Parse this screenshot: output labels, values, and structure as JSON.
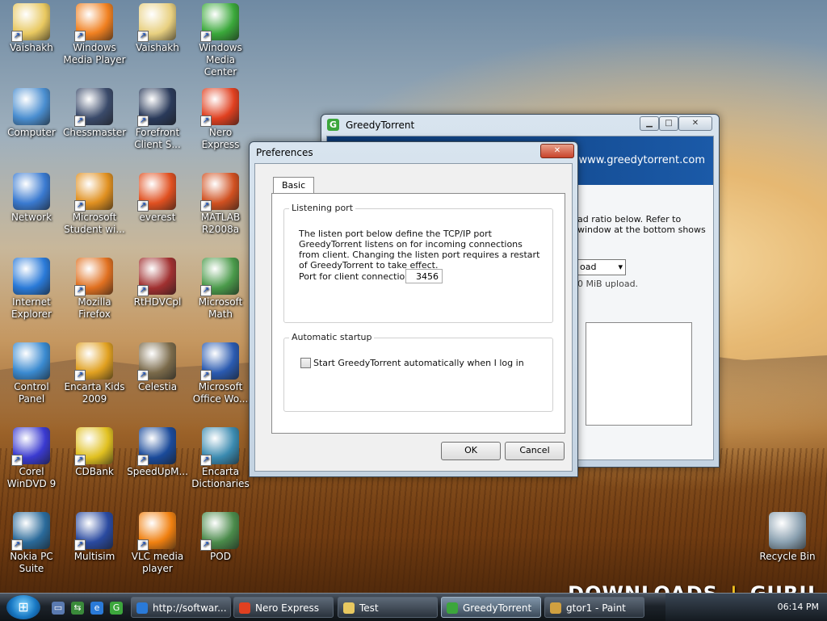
{
  "desktop": {
    "icons": [
      {
        "label": "Vaishakh",
        "icon": "folder-icon",
        "color": "#e8c860"
      },
      {
        "label": "Windows Media Player",
        "icon": "media-player-icon",
        "color": "#f08020"
      },
      {
        "label": "Vaishakh",
        "icon": "folder-doc-icon",
        "color": "#e8d080"
      },
      {
        "label": "Windows Media Center",
        "icon": "media-center-icon",
        "color": "#3aa83a"
      },
      {
        "label": "Computer",
        "icon": "computer-icon",
        "color": "#4a8ed0"
      },
      {
        "label": "Chessmaster",
        "icon": "chess-knight-icon",
        "color": "#3a4a6a"
      },
      {
        "label": "Forefront Client S...",
        "icon": "forefront-icon",
        "color": "#2a3a5a"
      },
      {
        "label": "Nero Express",
        "icon": "nero-icon",
        "color": "#e04020"
      },
      {
        "label": "Network",
        "icon": "network-icon",
        "color": "#3a7ad0"
      },
      {
        "label": "Microsoft Student wi...",
        "icon": "backpack-icon",
        "color": "#e09020"
      },
      {
        "label": "everest",
        "icon": "everest-icon",
        "color": "#e05020"
      },
      {
        "label": "MATLAB R2008a",
        "icon": "matlab-icon",
        "color": "#d05020"
      },
      {
        "label": "Internet Explorer",
        "icon": "internet-explorer-icon",
        "color": "#2a7ad8"
      },
      {
        "label": "Mozilla Firefox",
        "icon": "firefox-icon",
        "color": "#e07020"
      },
      {
        "label": "RtHDVCpl",
        "icon": "speaker-icon",
        "color": "#a03030"
      },
      {
        "label": "Microsoft Math",
        "icon": "calculator-icon",
        "color": "#4a9a4a"
      },
      {
        "label": "Control Panel",
        "icon": "control-panel-icon",
        "color": "#3a8ad0"
      },
      {
        "label": "Encarta Kids 2009",
        "icon": "encarta-kids-icon",
        "color": "#e0a020"
      },
      {
        "label": "Celestia",
        "icon": "planet-icon",
        "color": "#7a6a4a"
      },
      {
        "label": "Microsoft Office Wo...",
        "icon": "word-icon",
        "color": "#2a5ab0"
      },
      {
        "label": "Corel WinDVD 9",
        "icon": "dvd-icon",
        "color": "#3a3ad0"
      },
      {
        "label": "CDBank",
        "icon": "cd-icon",
        "color": "#e0c020"
      },
      {
        "label": "SpeedUpM...",
        "icon": "speedometer-icon",
        "color": "#1a4a9a"
      },
      {
        "label": "Encarta Dictionaries",
        "icon": "book-icon",
        "color": "#3a8ab0"
      },
      {
        "label": "Nokia PC Suite",
        "icon": "nokia-icon",
        "color": "#2a6a9a"
      },
      {
        "label": "Multisim",
        "icon": "multisim-icon",
        "color": "#2a4aa0"
      },
      {
        "label": "VLC media player",
        "icon": "vlc-cone-icon",
        "color": "#f08010"
      },
      {
        "label": "POD",
        "icon": "pod-icon",
        "color": "#4a8a4a"
      },
      {
        "label": "Recycle Bin",
        "icon": "recycle-bin-icon",
        "color": "#8aa0b0"
      }
    ]
  },
  "bg_window": {
    "title": "GreedyTorrent",
    "banner_url": "www.greedytorrent.com",
    "desc_text": "ad ratio below. Refer to window at the bottom shows",
    "combo_value": "oad",
    "upload_text": "0 MiB upload."
  },
  "prefs": {
    "title": "Preferences",
    "tab": "Basic",
    "listen_group": "Listening port",
    "listen_desc": "The listen port below define the TCP/IP port GreedyTorrent listens on for incoming connections from client. Changing the listen port requires a restart of GreedyTorrent to take effect.",
    "port_label": "Port for client connection",
    "port_value": "3456",
    "auto_group": "Automatic startup",
    "auto_label": "Start GreedyTorrent automatically when I log in",
    "auto_checked": false,
    "ok": "OK",
    "cancel": "Cancel"
  },
  "taskbar": {
    "items": [
      {
        "label": "http://softwar...",
        "icon": "internet-explorer-icon",
        "color": "#2a7ad8"
      },
      {
        "label": "Nero Express",
        "icon": "nero-icon",
        "color": "#e04020"
      },
      {
        "label": "Test",
        "icon": "folder-icon",
        "color": "#e8c860"
      },
      {
        "label": "GreedyTorrent",
        "icon": "greedytorrent-icon",
        "color": "#3ca63c"
      },
      {
        "label": "gtor1 - Paint",
        "icon": "paint-icon",
        "color": "#d0a040"
      }
    ],
    "clock": "06:14 PM"
  },
  "watermark": {
    "left": "DOWNLOADS",
    "right": "GURU"
  }
}
